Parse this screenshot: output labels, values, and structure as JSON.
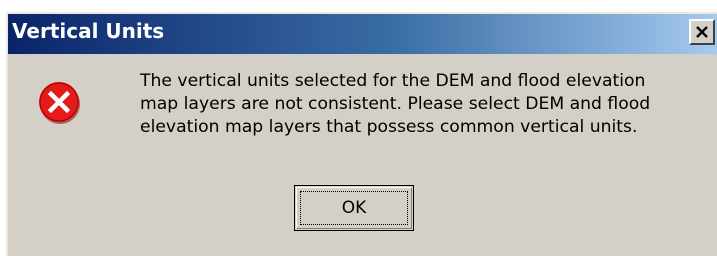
{
  "dialog": {
    "title": "Vertical Units",
    "close_icon": "close-icon",
    "error_icon": "error-icon",
    "message_lines": [
      "The vertical units selected for the DEM and flood elevation",
      "map layers are not consistent. Please select DEM and flood",
      "elevation map layers that possess common vertical units."
    ],
    "ok_label": "OK",
    "colors": {
      "face": "#d4d0c8",
      "title_start": "#0a246a",
      "title_end": "#a6caf0",
      "error_red": "#e31b1b"
    }
  }
}
